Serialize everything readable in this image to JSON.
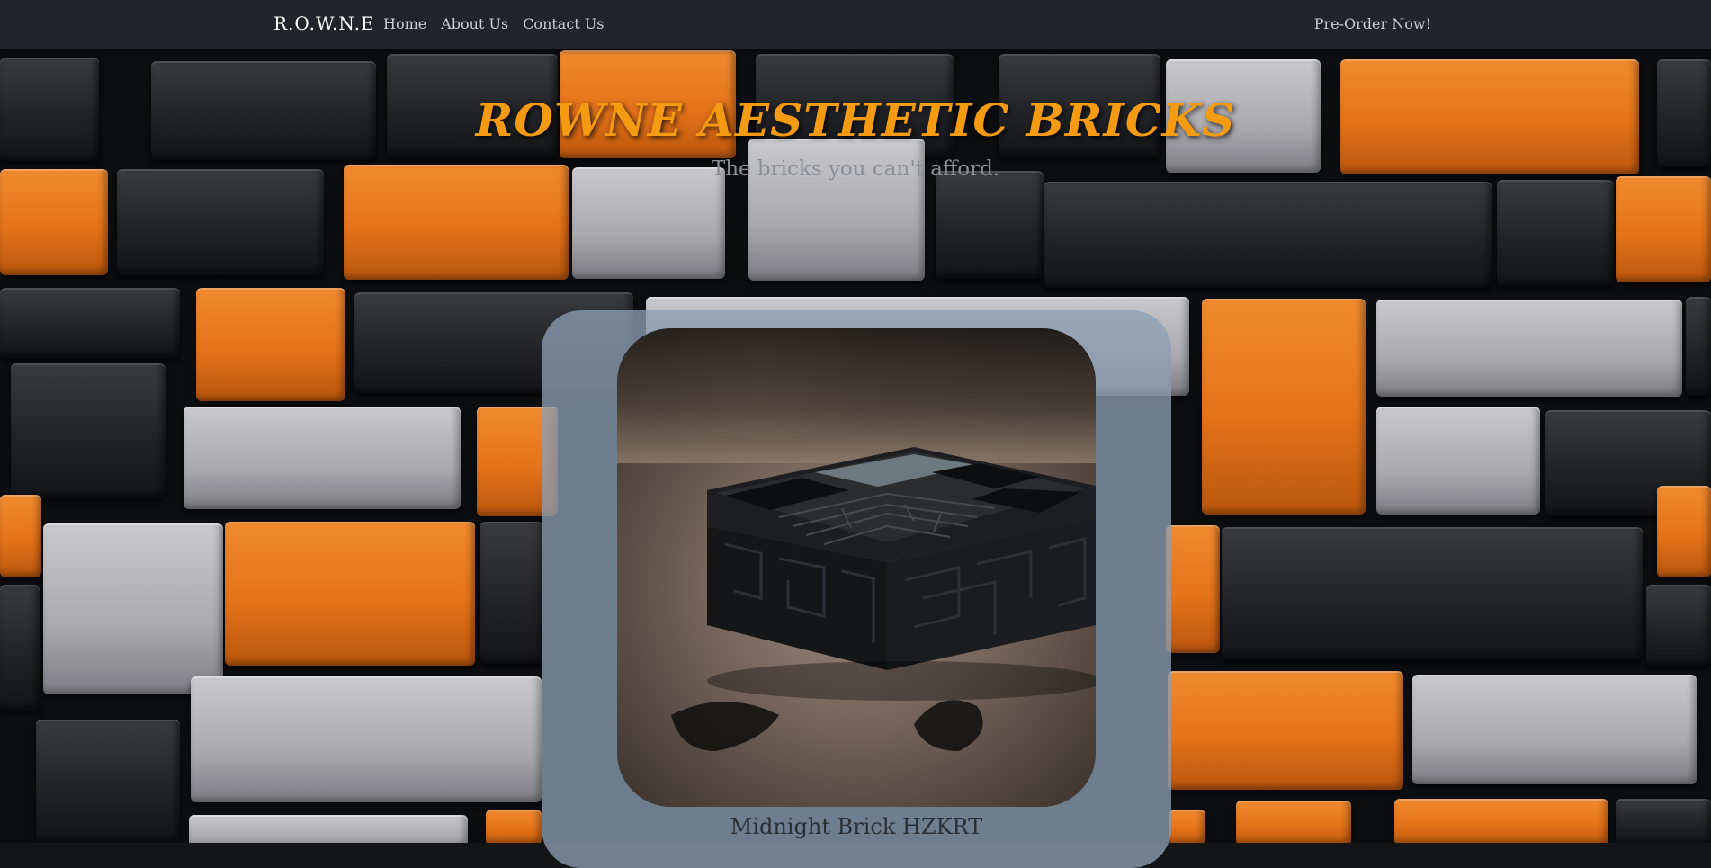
{
  "navbar": {
    "brand": "R.O.W.N.E",
    "links": [
      "Home",
      "About Us",
      "Contact Us"
    ],
    "cta": "Pre-Order Now!"
  },
  "hero": {
    "title": "ROWNE AESTHETIC BRICKS",
    "subtitle": "The bricks you can't afford."
  },
  "product": {
    "name": "Midnight Brick HZKRT",
    "image": "black maze-patterned brick box photo"
  },
  "colors": {
    "navbar_bg": "#212529",
    "title": "#f59b12",
    "card_bg": "#8c9eb2",
    "brick_orange": "#e4731a",
    "brick_gray": "#a9a9ae",
    "brick_black": "#232427"
  }
}
